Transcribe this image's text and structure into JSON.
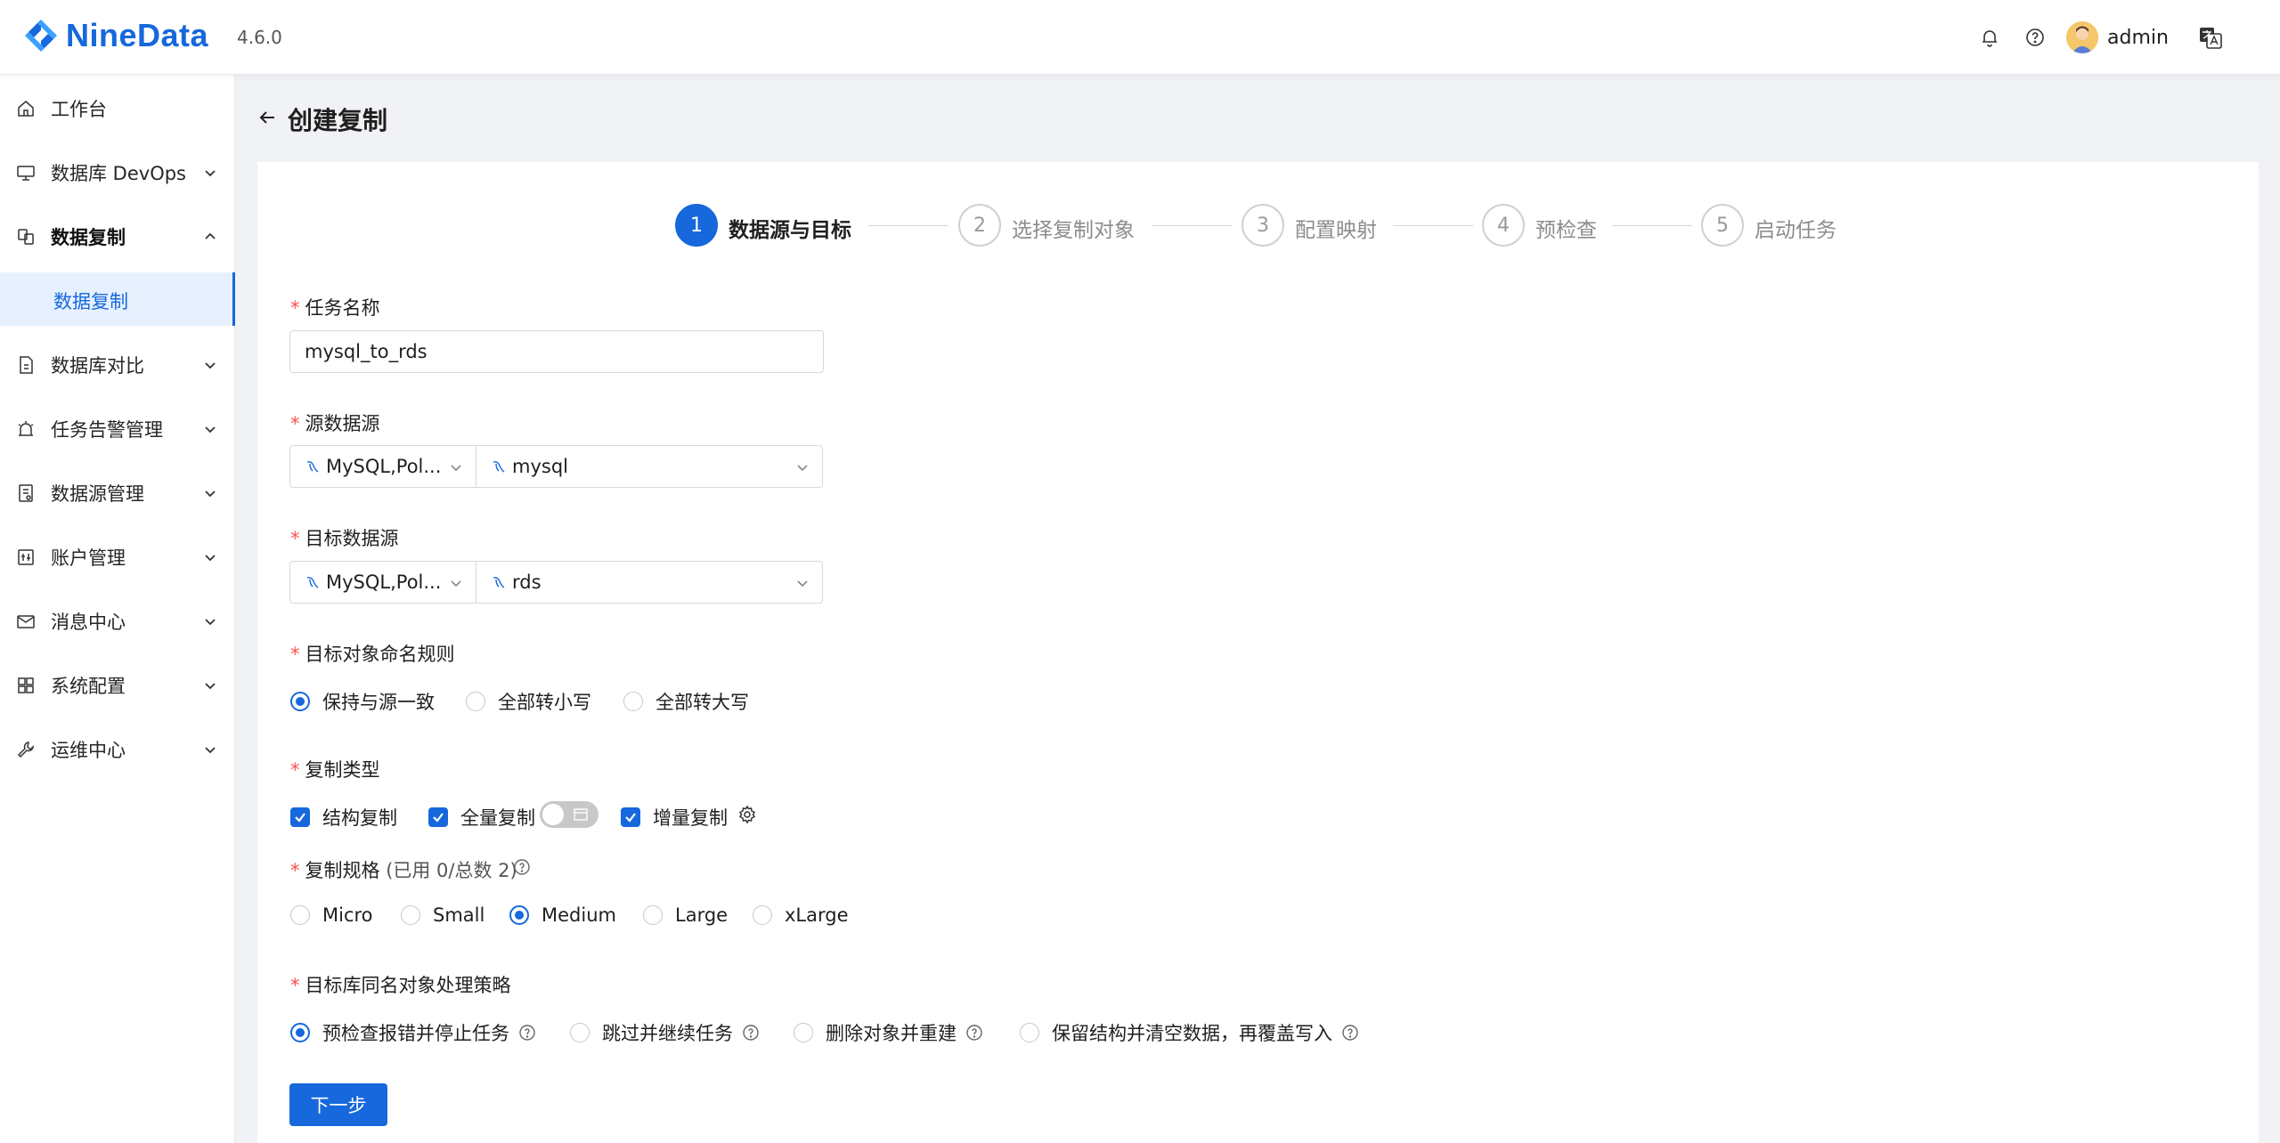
{
  "header": {
    "brand": "NineData",
    "version": "4.6.0",
    "user": "admin",
    "icons": [
      "bell-icon",
      "help-icon",
      "avatar",
      "translate-icon"
    ]
  },
  "sidebar": {
    "items": [
      {
        "label": "工作台",
        "icon": "home-icon"
      },
      {
        "label": "数据库 DevOps",
        "icon": "monitor-icon"
      },
      {
        "label": "数据复制",
        "icon": "replicate-icon"
      },
      {
        "label": "数据库对比",
        "icon": "compare-icon"
      },
      {
        "label": "任务告警管理",
        "icon": "alarm-icon"
      },
      {
        "label": "数据源管理",
        "icon": "datasource-icon"
      },
      {
        "label": "账户管理",
        "icon": "account-icon"
      },
      {
        "label": "消息中心",
        "icon": "mail-icon"
      },
      {
        "label": "系统配置",
        "icon": "grid-icon"
      },
      {
        "label": "运维中心",
        "icon": "wrench-icon"
      }
    ],
    "active_sub": "数据复制"
  },
  "page": {
    "title": "创建复制"
  },
  "steps": [
    {
      "num": "1",
      "label": "数据源与目标",
      "active": true
    },
    {
      "num": "2",
      "label": "选择复制对象"
    },
    {
      "num": "3",
      "label": "配置映射"
    },
    {
      "num": "4",
      "label": "预检查"
    },
    {
      "num": "5",
      "label": "启动任务"
    }
  ],
  "form": {
    "required_mark": "*",
    "task_name": {
      "label": "任务名称",
      "value": "mysql_to_rds"
    },
    "source": {
      "label": "源数据源",
      "type": "MySQL,Pol...",
      "value": "mysql"
    },
    "target": {
      "label": "目标数据源",
      "type": "MySQL,Pol...",
      "value": "rds"
    },
    "naming": {
      "label": "目标对象命名规则",
      "options": [
        "保持与源一致",
        "全部转小写",
        "全部转大写"
      ],
      "selected": "保持与源一致"
    },
    "copy_type": {
      "label": "复制类型",
      "options": [
        "结构复制",
        "全量复制",
        "增量复制"
      ],
      "checked": [
        "结构复制",
        "全量复制",
        "增量复制"
      ],
      "full_toggle_on": false
    },
    "spec": {
      "label": "复制规格",
      "quota": "(已用 0/总数 2)",
      "options": [
        "Micro",
        "Small",
        "Medium",
        "Large",
        "xLarge"
      ],
      "selected": "Medium"
    },
    "conflict": {
      "label": "目标库同名对象处理策略",
      "options": [
        "预检查报错并停止任务",
        "跳过并继续任务",
        "删除对象并重建",
        "保留结构并清空数据，再覆盖写入"
      ],
      "selected": "预检查报错并停止任务"
    },
    "next_label": "下一步"
  },
  "colors": {
    "primary": "#1668dc",
    "required": "#ff4d4f"
  }
}
